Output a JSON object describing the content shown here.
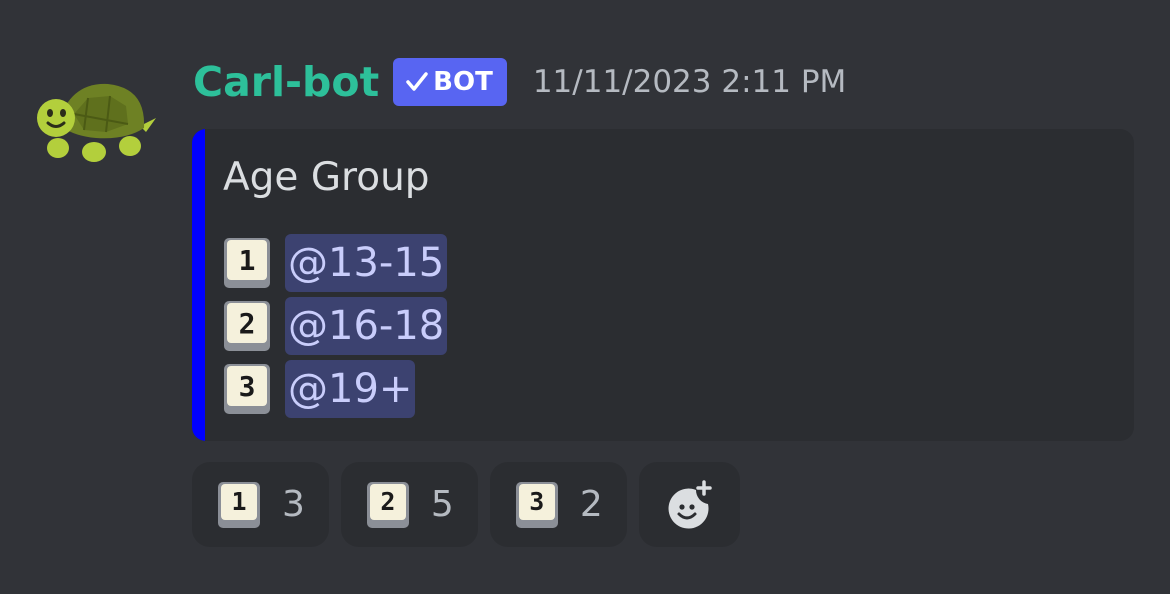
{
  "message": {
    "author": "Carl-bot",
    "bot_tag": "BOT",
    "timestamp": "11/11/2023 2:11 PM",
    "avatar_icon": "turtle-icon"
  },
  "embed": {
    "accent_color": "#0000ff",
    "title": "Age Group",
    "roles": [
      {
        "emoji": "1",
        "mention": "@13-15"
      },
      {
        "emoji": "2",
        "mention": "@16-18"
      },
      {
        "emoji": "3",
        "mention": "@19+"
      }
    ]
  },
  "reactions": [
    {
      "emoji": "1",
      "count": "3"
    },
    {
      "emoji": "2",
      "count": "5"
    },
    {
      "emoji": "3",
      "count": "2"
    }
  ],
  "add_reaction_icon": "add-reaction-icon",
  "colors": {
    "background": "#313338",
    "author": "#2dc09a",
    "bot_tag": "#5865f2",
    "mention_bg": "#3c4270",
    "mention_text": "#c9cdfb"
  }
}
